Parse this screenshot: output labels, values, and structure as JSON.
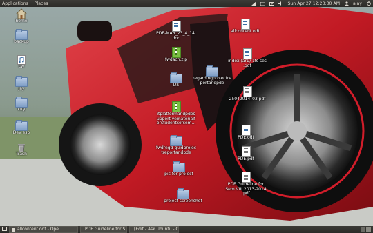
{
  "topbar": {
    "applications": "Applications",
    "places": "Places",
    "clock": "Sun Apr 27 12:23:30 AM",
    "user": "ajay"
  },
  "desktop_icons": [
    {
      "label": "home",
      "type": "home",
      "col": 0,
      "row": 0
    },
    {
      "label": "backup",
      "type": "folder"
    },
    {
      "label": "cw",
      "type": "audio"
    },
    {
      "label": "jay",
      "type": "folder"
    },
    {
      "label": "kity",
      "type": "folder"
    },
    {
      "label": "Dev esp",
      "type": "folder"
    },
    {
      "label": "Trash",
      "type": "trash"
    },
    {
      "label": "PDE-MAR_23_4_14.\ndoc",
      "type": "writer"
    },
    {
      "label": "fwdacn.zip",
      "type": "zip"
    },
    {
      "label": "DS",
      "type": "folder"
    },
    {
      "label": "itplatformandpdes\nupportivematerialf\norstudentsofsem...",
      "type": "zip"
    },
    {
      "label": "fwdregd-guidprojec\ntreportandpde",
      "type": "folder"
    },
    {
      "label": "pic for project",
      "type": "folder"
    },
    {
      "label": "project screenshot",
      "type": "folder"
    },
    {
      "label": "regardingprojectre\nportandpde",
      "type": "folder"
    },
    {
      "label": "allcontent.odt",
      "type": "writer"
    },
    {
      "label": "index (ar1) 1fs ses\n.odt",
      "type": "writer"
    },
    {
      "label": "25042014_03.pdf",
      "type": "pdf"
    },
    {
      "label": "PDE.odt",
      "type": "writer"
    },
    {
      "label": "PDE.pdf",
      "type": "pdf"
    },
    {
      "label": "PDE Guideline for\nSem VIII 2013-2014\n.pdf",
      "type": "pdf"
    }
  ],
  "taskbar": [
    {
      "label": "allcontent.odt - Ope..."
    },
    {
      "label": "PDE Guideline for S..."
    },
    {
      "label": "[Edit - Ask Ubuntu - C..."
    }
  ]
}
